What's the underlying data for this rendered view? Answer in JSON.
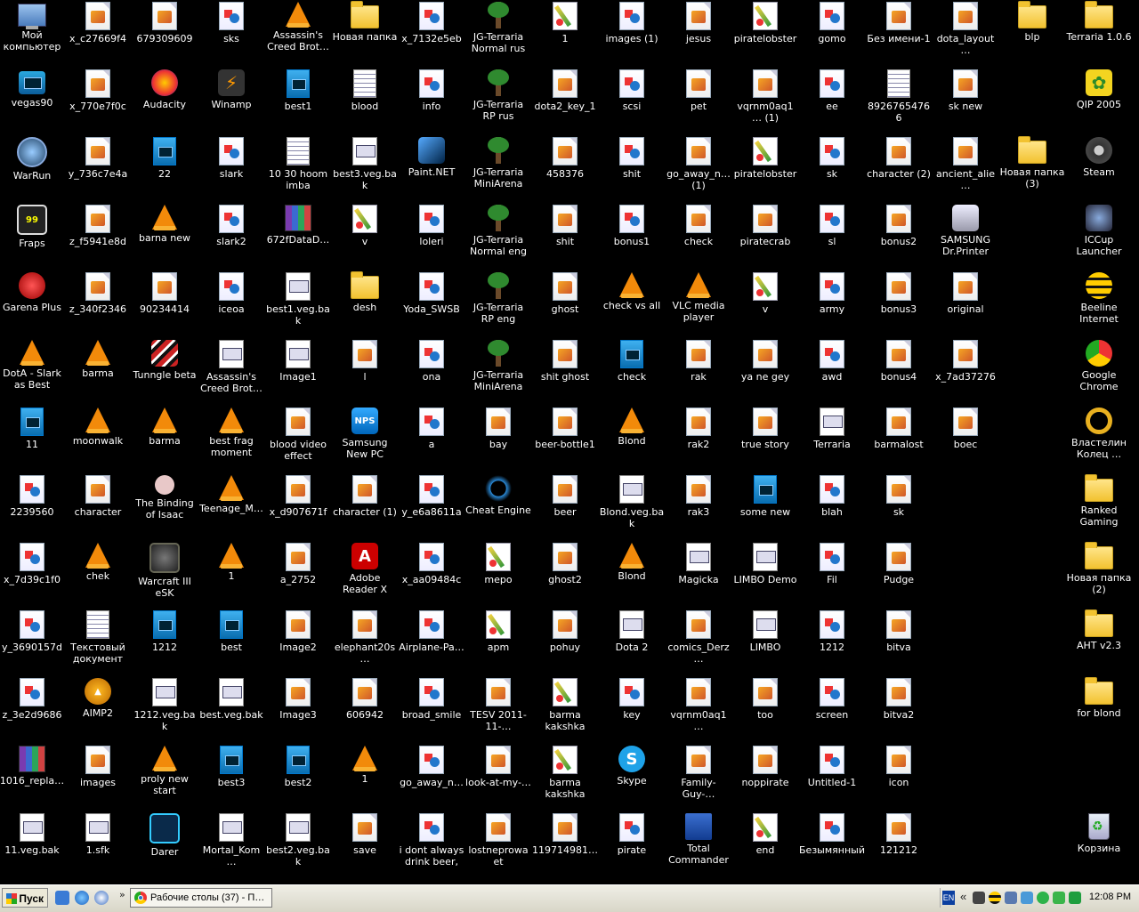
{
  "desktop": {
    "columns": [
      [
        "Мой компьютер",
        "vegas90",
        "WarRun",
        "Fraps",
        "Garena Plus",
        "DotA - Slark as Best Dodger",
        "11",
        "2239560",
        "x_7d39c1f0",
        "y_3690157d",
        "z_3e2d9686",
        "1016_repla…",
        "11.veg.bak"
      ],
      [
        "x_c27669f4",
        "x_770e7f0c",
        "y_736c7e4a",
        "z_f5941e8d",
        "z_340f2346",
        "barma",
        "moonwalk",
        "character",
        "chek",
        "Текстовый документ",
        "AIMP2",
        "images",
        "1.sfk"
      ],
      [
        "679309609",
        "Audacity",
        "22",
        "barna new",
        "90234414",
        "Tunngle beta",
        "barma",
        "The Binding of Isaac",
        "Warcraft III eSK",
        "1212",
        "1212.veg.bak",
        "proly new start",
        "Darer"
      ],
      [
        "sks",
        "Winamp",
        "slark",
        "slark2",
        "iceoa",
        "Assassin's Creed Brot…",
        "best frag moment",
        "Teenage_M…",
        "1",
        "best",
        "best.veg.bak",
        "best3",
        "Mortal_Kom…"
      ],
      [
        "Assassin's Creed Brot…",
        "best1",
        "10 30 hoom imba",
        "672fDataD…",
        "best1.veg.bak",
        "Image1",
        "blood video effect",
        "x_d907671f",
        "a_2752",
        "Image2",
        "Image3",
        "best2",
        "best2.veg.bak"
      ],
      [
        "Новая папка",
        "blood",
        "best3.veg.bak",
        "v",
        "desh",
        "l",
        "Samsung New PC Studio",
        "character (1)",
        "Adobe Reader X",
        "elephant20s…",
        "606942",
        "1",
        "save"
      ],
      [
        "x_7132e5eb",
        "info",
        "Paint.NET",
        "loleri",
        "Yoda_SWSB",
        "ona",
        "a",
        "y_e6a8611a",
        "x_aa09484c",
        "Airplane-Pa…",
        "broad_smile",
        "go_away_n…",
        "i dont always drink beer, …"
      ],
      [
        "JG-Terraria Normal rus",
        "JG-Terraria RP rus",
        "JG-Terraria MiniArena rus",
        "JG-Terraria Normal eng",
        "JG-Terraria RP eng",
        "JG-Terraria MiniArena eng",
        "bay",
        "Cheat Engine",
        "mepo",
        "apm",
        "TESV 2011-11-…",
        "look-at-my-…",
        "lostneprowaet"
      ],
      [
        "1",
        "dota2_key_1",
        "458376",
        "shit",
        "ghost",
        "shit ghost",
        "beer-bottle1",
        "beer",
        "ghost2",
        "pohuy",
        "barma kakshka",
        "barma kakshka",
        "119714981…"
      ],
      [
        "images (1)",
        "scsi",
        "shit",
        "bonus1",
        "check vs all",
        "check",
        "Blond",
        "Blond.veg.bak",
        "Blond",
        "Dota 2",
        "key",
        "Skype",
        "pirate"
      ],
      [
        "jesus",
        "pet",
        "go_away_n… (1)",
        "check",
        "VLC media player",
        "rak",
        "rak2",
        "rak3",
        "Magicka",
        "comics_Derz…",
        "vqrnm0aq1…",
        "Family-Guy-…",
        "Total Commander"
      ],
      [
        "piratelobster",
        "vqrnm0aq1… (1)",
        "piratelobster",
        "piratecrab",
        "v",
        "ya ne gey",
        "true story",
        "some new",
        "LIMBO Demo",
        "LIMBO",
        "too",
        "noppirate",
        "end"
      ],
      [
        "gomo",
        "ee",
        "sk",
        "sl",
        "army",
        "awd",
        "Terraria",
        "blah",
        "Fil",
        "1212",
        "screen",
        "Untitled-1",
        "Безымянный"
      ],
      [
        "Без имени-1",
        "89267654766",
        "character (2)",
        "bonus2",
        "bonus3",
        "bonus4",
        "barmalost",
        "sk",
        "Pudge",
        "bitva",
        "bitva2",
        "icon",
        "121212"
      ],
      [
        "dota_layout…",
        "sk new",
        "ancient_alie…",
        "SAMSUNG Dr.Printer",
        "original",
        "x_7ad37276",
        "boec"
      ],
      [
        "blp",
        "",
        "Новая папка (3)"
      ],
      [
        "Terraria 1.0.6",
        "QIP 2005",
        "Steam",
        "ICCup Launcher",
        "Beeline Internet",
        "Google Chrome",
        "Властелин Колец …",
        "Ranked Gaming Client",
        "Новая папка (2)",
        "AHT v2.3",
        "for blond",
        "",
        "Корзина"
      ]
    ]
  },
  "taskbar": {
    "start_label": "Пуск",
    "chevron": "»",
    "task_title": "Рабочие столы (37) - П…",
    "lang": "EN",
    "tray_chevron": "«",
    "clock": "12:08 PM"
  },
  "colors": {
    "desktop_bg": "#000000",
    "taskbar_bg": "#ece9d8"
  }
}
